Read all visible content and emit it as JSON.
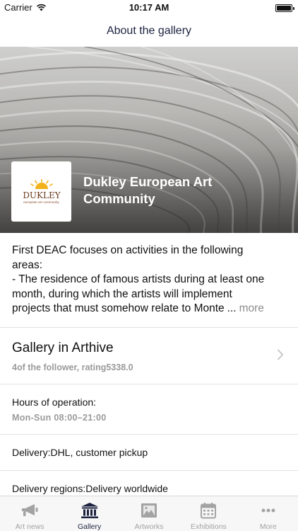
{
  "status_bar": {
    "carrier": "Carrier",
    "time": "10:17 AM"
  },
  "nav": {
    "title": "About the gallery"
  },
  "gallery": {
    "name_line1": "Dukley European Art",
    "name_line2": "Community",
    "logo_word": "DUKLEY",
    "logo_tagline": "european art community"
  },
  "description": {
    "lines": [
      "First DEAC focuses on activities in the following",
      "areas:",
      "- The residence of famous artists during at least one",
      "month, during which the artists will implement"
    ],
    "last_line": "projects that must somehow relate to Monte",
    "ellipsis": "...",
    "more": "more"
  },
  "arthive": {
    "title": "Gallery in Arthive",
    "stats": "4of the follower, rating5338.0"
  },
  "hours": {
    "label": "Hours of operation:",
    "value": "Mon-Sun 08:00–21:00"
  },
  "delivery": "Delivery:DHL, customer pickup",
  "delivery_regions": "Delivery regions:Delivery worldwide",
  "tabs": [
    {
      "label": "Art news",
      "icon": "megaphone-icon",
      "active": false
    },
    {
      "label": "Gallery",
      "icon": "museum-icon",
      "active": true
    },
    {
      "label": "Artworks",
      "icon": "picture-icon",
      "active": false
    },
    {
      "label": "Exhibitions",
      "icon": "calendar-icon",
      "active": false
    },
    {
      "label": "More",
      "icon": "more-dots-icon",
      "active": false
    }
  ],
  "colors": {
    "accent": "#1c2340",
    "inactive": "#a3a3a3",
    "logo_sun": "#f2b21c",
    "logo_text": "#6b3a1f"
  }
}
